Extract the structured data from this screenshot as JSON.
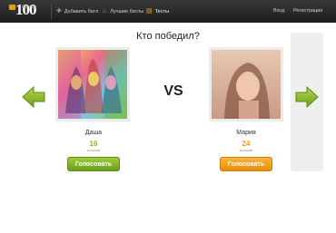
{
  "header": {
    "logo_text": "100",
    "logo_subtext": "батлов",
    "nav": [
      {
        "label": "Добавить батл",
        "icon": "plus-icon"
      },
      {
        "label": "Лучшие батлы",
        "icon": "flame-icon"
      },
      {
        "label": "Тесты",
        "icon": "list-icon"
      }
    ],
    "login_label": "Вход",
    "register_label": "Регистрация"
  },
  "main": {
    "title": "Кто победил?",
    "vs_label": "VS",
    "left": {
      "name": "Даша",
      "votes": "16",
      "votes_label": "голосов",
      "button_label": "Голосовать"
    },
    "right": {
      "name": "Мария",
      "votes": "24",
      "votes_label": "голосов",
      "button_label": "Голосовать"
    }
  },
  "colors": {
    "accent_green": "#8fb51c",
    "accent_orange": "#f2a31a",
    "header_bg": "#2a2a2a"
  }
}
